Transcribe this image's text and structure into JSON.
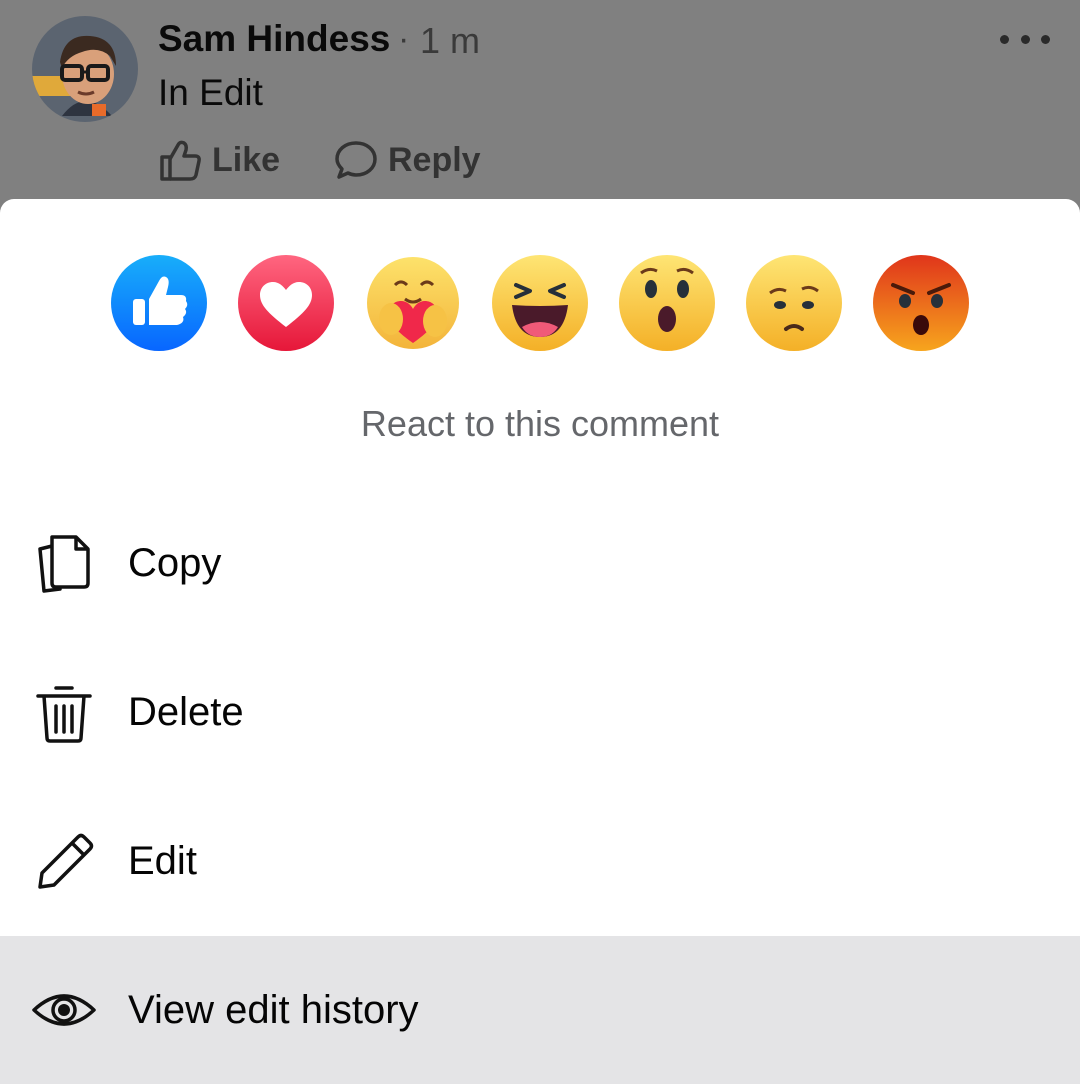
{
  "comment": {
    "author": "Sam Hindess",
    "separator": "·",
    "time": "1 m",
    "text": "In Edit",
    "actions": {
      "like": "Like",
      "reply": "Reply"
    }
  },
  "reactions": {
    "items": [
      {
        "name": "like",
        "color": "#1877f2"
      },
      {
        "name": "love",
        "color": "#f33e58"
      },
      {
        "name": "care",
        "color": "#f7c33b"
      },
      {
        "name": "haha",
        "color": "#f7b125"
      },
      {
        "name": "wow",
        "color": "#f7b125"
      },
      {
        "name": "sad",
        "color": "#f7b125"
      },
      {
        "name": "angry",
        "color": "#e9710f"
      }
    ],
    "label": "React to this comment"
  },
  "menu": {
    "copy": "Copy",
    "delete": "Delete",
    "edit": "Edit",
    "view_history": "View edit history"
  },
  "icons": {
    "more": "more-horizontal-icon",
    "like": "thumbs-up-outline-icon",
    "reply": "speech-bubble-icon",
    "copy": "copy-icon",
    "delete": "trash-icon",
    "edit": "pencil-icon",
    "view_history": "eye-icon"
  }
}
